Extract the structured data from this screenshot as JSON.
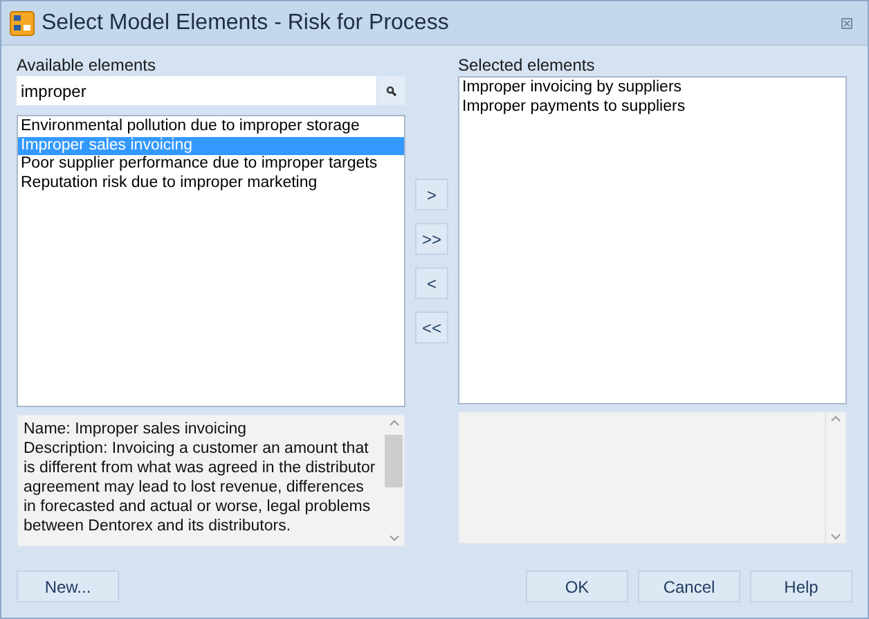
{
  "window": {
    "title": "Select Model Elements - Risk for Process"
  },
  "available": {
    "label": "Available elements",
    "search": {
      "value": "improper"
    },
    "items": [
      {
        "label": "Environmental pollution due to improper storage",
        "selected": false
      },
      {
        "label": "Improper sales invoicing",
        "selected": true
      },
      {
        "label": "Poor supplier performance due to improper targets",
        "selected": false
      },
      {
        "label": "Reputation risk due to improper marketing",
        "selected": false
      }
    ],
    "details": [
      "Name: Improper sales invoicing",
      "Description: Invoicing a customer an amount that is different from what was agreed in the distributor agreement may lead to lost revenue, differences in forecasted and actual or worse, legal problems between Dentorex and its distributors."
    ]
  },
  "move_buttons": [
    ">",
    ">>",
    "<",
    "<<"
  ],
  "selected": {
    "label": "Selected elements",
    "items": [
      {
        "label": "Improper invoicing by suppliers",
        "selected": false
      },
      {
        "label": "Improper payments to suppliers",
        "selected": false
      }
    ]
  },
  "buttons": {
    "left": [
      "New..."
    ],
    "right": [
      "OK",
      "Cancel",
      "Help"
    ]
  }
}
